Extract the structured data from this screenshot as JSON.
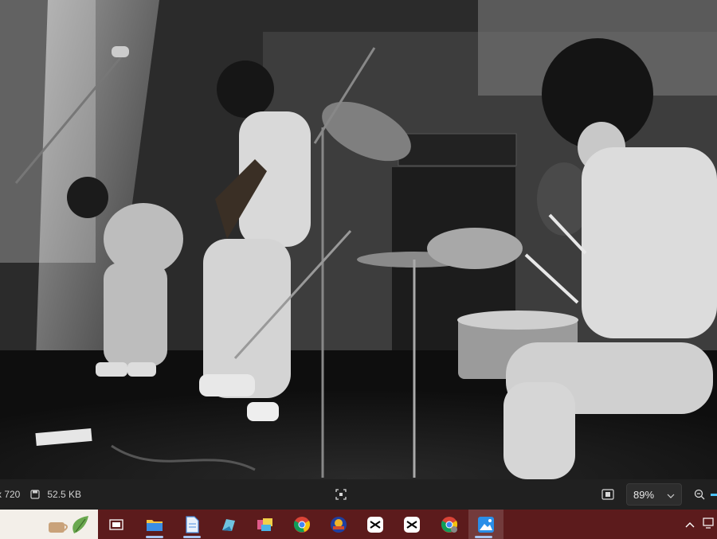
{
  "viewer": {
    "dimensions_text": "x 720",
    "file_size": "52.5 KB",
    "zoom_level": "89%"
  },
  "photo": {
    "description_icon": "concert-photo"
  },
  "taskbar": {
    "apps": [
      {
        "name": "task-view"
      },
      {
        "name": "file-explorer"
      },
      {
        "name": "notepad"
      },
      {
        "name": "photos-app"
      },
      {
        "name": "media-app"
      },
      {
        "name": "chrome"
      },
      {
        "name": "app-circle"
      },
      {
        "name": "capcut"
      },
      {
        "name": "capcut-2"
      },
      {
        "name": "chrome-2"
      },
      {
        "name": "photos-viewer"
      }
    ]
  },
  "colors": {
    "taskbar_bg": "#5c1b1c",
    "accent": "#4cc2ff"
  }
}
